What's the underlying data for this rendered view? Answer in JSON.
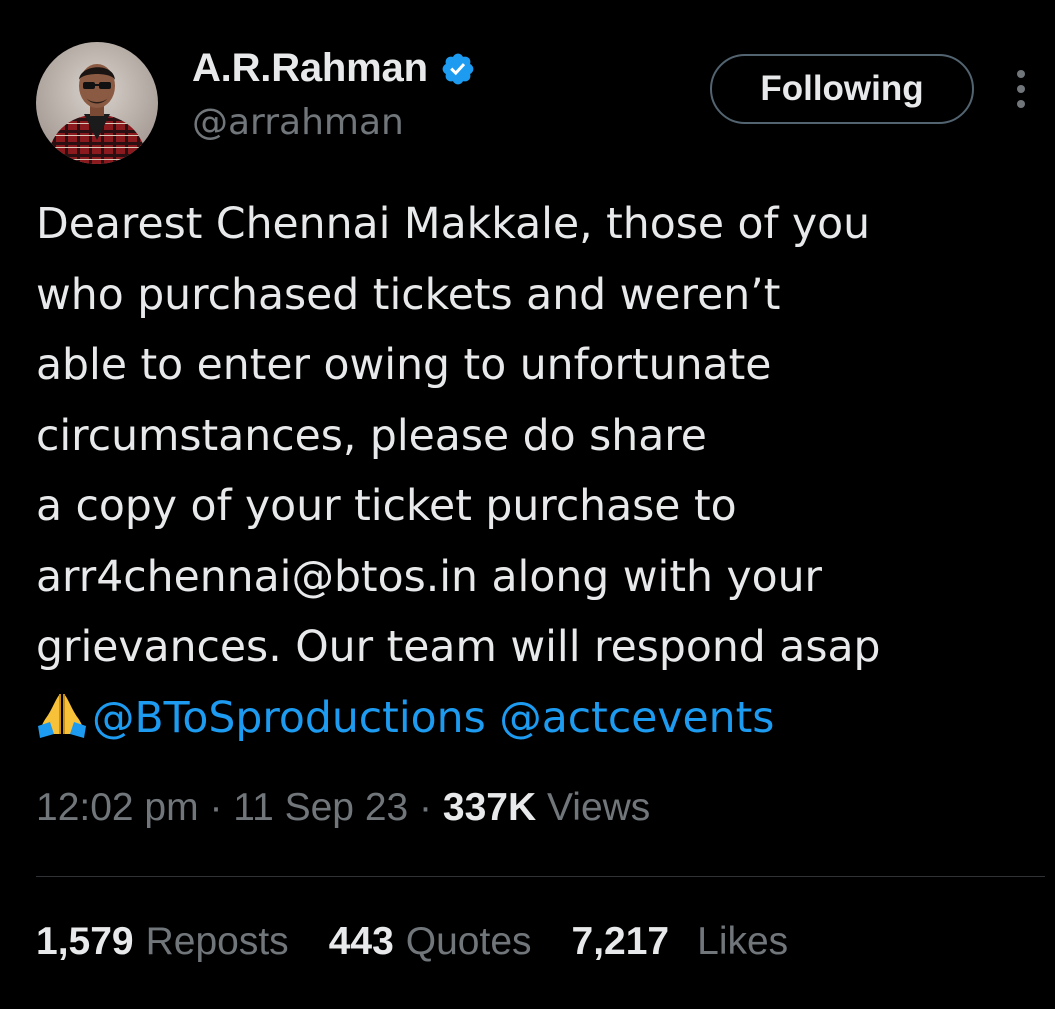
{
  "user": {
    "display_name": "A.R.Rahman",
    "handle": "@arrahman",
    "verified_icon": "verified-badge-icon",
    "verified_color": "#1d9bf0"
  },
  "header": {
    "follow_button_label": "Following",
    "more_icon": "more-vertical-icon"
  },
  "tweet": {
    "lines": [
      "Dearest Chennai Makkale, those of you",
      "who purchased tickets and weren’t",
      "able to enter owing to unfortunate",
      "circumstances, please do share",
      "a copy of your ticket purchase to",
      "arr4chennai@btos.in along with your",
      "grievances. Our team will respond asap"
    ],
    "emoji": "folded-hands-icon",
    "mentions": [
      "@BToSproductions",
      "@actcevents"
    ],
    "mention_color": "#1d9bf0"
  },
  "meta": {
    "time": "12:02 pm",
    "separator": " · ",
    "date": "11 Sep 23",
    "views_count": "337K",
    "views_label": "Views"
  },
  "stats": {
    "reposts_count": "1,579",
    "reposts_label": "Reposts",
    "quotes_count": "443",
    "quotes_label": "Quotes",
    "likes_count": "7,217",
    "likes_label": "Likes"
  },
  "colors": {
    "background": "#000000",
    "primary_text": "#e7e9ea",
    "secondary_text": "#71767b",
    "divider": "#2f3336",
    "button_border": "#536471"
  }
}
